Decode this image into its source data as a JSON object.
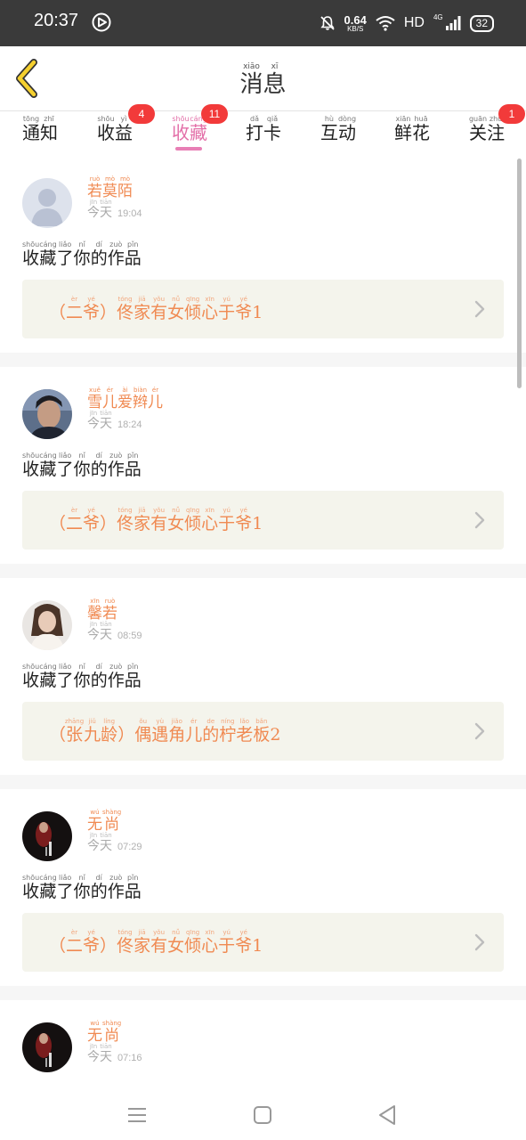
{
  "status_bar": {
    "time": "20:37",
    "net_speed": "0.64",
    "net_unit": "KB/S",
    "hd": "HD",
    "network": "4G",
    "battery": "32"
  },
  "header": {
    "title": [
      {
        "c": "消",
        "p": "xiāo"
      },
      {
        "c": "息",
        "p": "xī"
      }
    ]
  },
  "tabs": [
    {
      "chars": [
        {
          "c": "通",
          "p": "tōng"
        },
        {
          "c": "知",
          "p": "zhī"
        }
      ],
      "badge": "",
      "active": false
    },
    {
      "chars": [
        {
          "c": "收",
          "p": "shōu"
        },
        {
          "c": "益",
          "p": "yì"
        }
      ],
      "badge": "4",
      "active": false
    },
    {
      "chars": [
        {
          "c": "收",
          "p": "shōu"
        },
        {
          "c": "藏",
          "p": "cáng"
        }
      ],
      "badge": "11",
      "active": true
    },
    {
      "chars": [
        {
          "c": "打",
          "p": "dǎ"
        },
        {
          "c": "卡",
          "p": "qiǎ"
        }
      ],
      "badge": "",
      "active": false
    },
    {
      "chars": [
        {
          "c": "互",
          "p": "hù"
        },
        {
          "c": "动",
          "p": "dòng"
        }
      ],
      "badge": "",
      "active": false
    },
    {
      "chars": [
        {
          "c": "鲜",
          "p": "xiān"
        },
        {
          "c": "花",
          "p": "huā"
        }
      ],
      "badge": "",
      "active": false
    },
    {
      "chars": [
        {
          "c": "关",
          "p": "guān"
        },
        {
          "c": "注",
          "p": "zhù"
        }
      ],
      "badge": "1",
      "active": false
    }
  ],
  "day_label": [
    {
      "c": "今",
      "p": "jīn"
    },
    {
      "c": "天",
      "p": "tiān"
    }
  ],
  "action_text": [
    {
      "c": "收",
      "p": "shōu"
    },
    {
      "c": "藏",
      "p": "cáng"
    },
    {
      "c": "了",
      "p": "liǎo"
    },
    {
      "c": "你",
      "p": "nǐ"
    },
    {
      "c": "的",
      "p": "dí"
    },
    {
      "c": "作",
      "p": "zuò"
    },
    {
      "c": "品",
      "p": "pǐn"
    }
  ],
  "notifications": [
    {
      "user": [
        {
          "c": "若",
          "p": "ruò"
        },
        {
          "c": "莫",
          "p": "mò"
        },
        {
          "c": "陌",
          "p": "mò"
        }
      ],
      "time": "19:04",
      "avatar": "default",
      "work": [
        {
          "c": "（",
          "p": ""
        },
        {
          "c": "二",
          "p": "èr"
        },
        {
          "c": "爷",
          "p": "yé"
        },
        {
          "c": "）",
          "p": ""
        },
        {
          "c": "佟",
          "p": "tóng"
        },
        {
          "c": "家",
          "p": "jiā"
        },
        {
          "c": "有",
          "p": "yǒu"
        },
        {
          "c": "女",
          "p": "nǚ"
        },
        {
          "c": "倾",
          "p": "qīng"
        },
        {
          "c": "心",
          "p": "xīn"
        },
        {
          "c": "于",
          "p": "yú"
        },
        {
          "c": "爷",
          "p": "yé"
        },
        {
          "c": "1",
          "p": ""
        }
      ]
    },
    {
      "user": [
        {
          "c": "雪",
          "p": "xuě"
        },
        {
          "c": "儿",
          "p": "ér"
        },
        {
          "c": "爱",
          "p": "ài"
        },
        {
          "c": "辫",
          "p": "biàn"
        },
        {
          "c": "儿",
          "p": "ér"
        }
      ],
      "time": "18:24",
      "avatar": "photo-male",
      "work": [
        {
          "c": "（",
          "p": ""
        },
        {
          "c": "二",
          "p": "èr"
        },
        {
          "c": "爷",
          "p": "yé"
        },
        {
          "c": "）",
          "p": ""
        },
        {
          "c": "佟",
          "p": "tóng"
        },
        {
          "c": "家",
          "p": "jiā"
        },
        {
          "c": "有",
          "p": "yǒu"
        },
        {
          "c": "女",
          "p": "nǚ"
        },
        {
          "c": "倾",
          "p": "qīng"
        },
        {
          "c": "心",
          "p": "xīn"
        },
        {
          "c": "于",
          "p": "yú"
        },
        {
          "c": "爷",
          "p": "yé"
        },
        {
          "c": "1",
          "p": ""
        }
      ]
    },
    {
      "user": [
        {
          "c": "馨",
          "p": "xīn"
        },
        {
          "c": "若",
          "p": "ruò"
        }
      ],
      "time": "08:59",
      "avatar": "photo-female",
      "work": [
        {
          "c": "（",
          "p": ""
        },
        {
          "c": "张",
          "p": "zhāng"
        },
        {
          "c": "九",
          "p": "jiǔ"
        },
        {
          "c": "龄",
          "p": "líng"
        },
        {
          "c": "）",
          "p": ""
        },
        {
          "c": "偶",
          "p": "ǒu"
        },
        {
          "c": "遇",
          "p": "yù"
        },
        {
          "c": "角",
          "p": "jiǎo"
        },
        {
          "c": "儿",
          "p": "ér"
        },
        {
          "c": "的",
          "p": "de"
        },
        {
          "c": "柠",
          "p": "níng"
        },
        {
          "c": "老",
          "p": "lǎo"
        },
        {
          "c": "板",
          "p": "bǎn"
        },
        {
          "c": "2",
          "p": ""
        }
      ]
    },
    {
      "user": [
        {
          "c": "无",
          "p": "wú"
        },
        {
          "c": "尚",
          "p": "shàng"
        }
      ],
      "time": "07:29",
      "avatar": "photo-dark",
      "work": [
        {
          "c": "（",
          "p": ""
        },
        {
          "c": "二",
          "p": "èr"
        },
        {
          "c": "爷",
          "p": "yé"
        },
        {
          "c": "）",
          "p": ""
        },
        {
          "c": "佟",
          "p": "tóng"
        },
        {
          "c": "家",
          "p": "jiā"
        },
        {
          "c": "有",
          "p": "yǒu"
        },
        {
          "c": "女",
          "p": "nǚ"
        },
        {
          "c": "倾",
          "p": "qīng"
        },
        {
          "c": "心",
          "p": "xīn"
        },
        {
          "c": "于",
          "p": "yú"
        },
        {
          "c": "爷",
          "p": "yé"
        },
        {
          "c": "1",
          "p": ""
        }
      ]
    },
    {
      "user": [
        {
          "c": "无",
          "p": "wú"
        },
        {
          "c": "尚",
          "p": "shàng"
        }
      ],
      "time": "07:16",
      "avatar": "photo-dark",
      "work": null
    }
  ],
  "nav": {
    "icons": [
      "menu-icon",
      "home-square-icon",
      "back-triangle-icon"
    ]
  },
  "colors": {
    "accent": "#e36fa8",
    "username": "#f08a52",
    "badge": "#f23a3a",
    "back_arrow": "#f5d02f",
    "work_bg": "#f4f4ec"
  }
}
